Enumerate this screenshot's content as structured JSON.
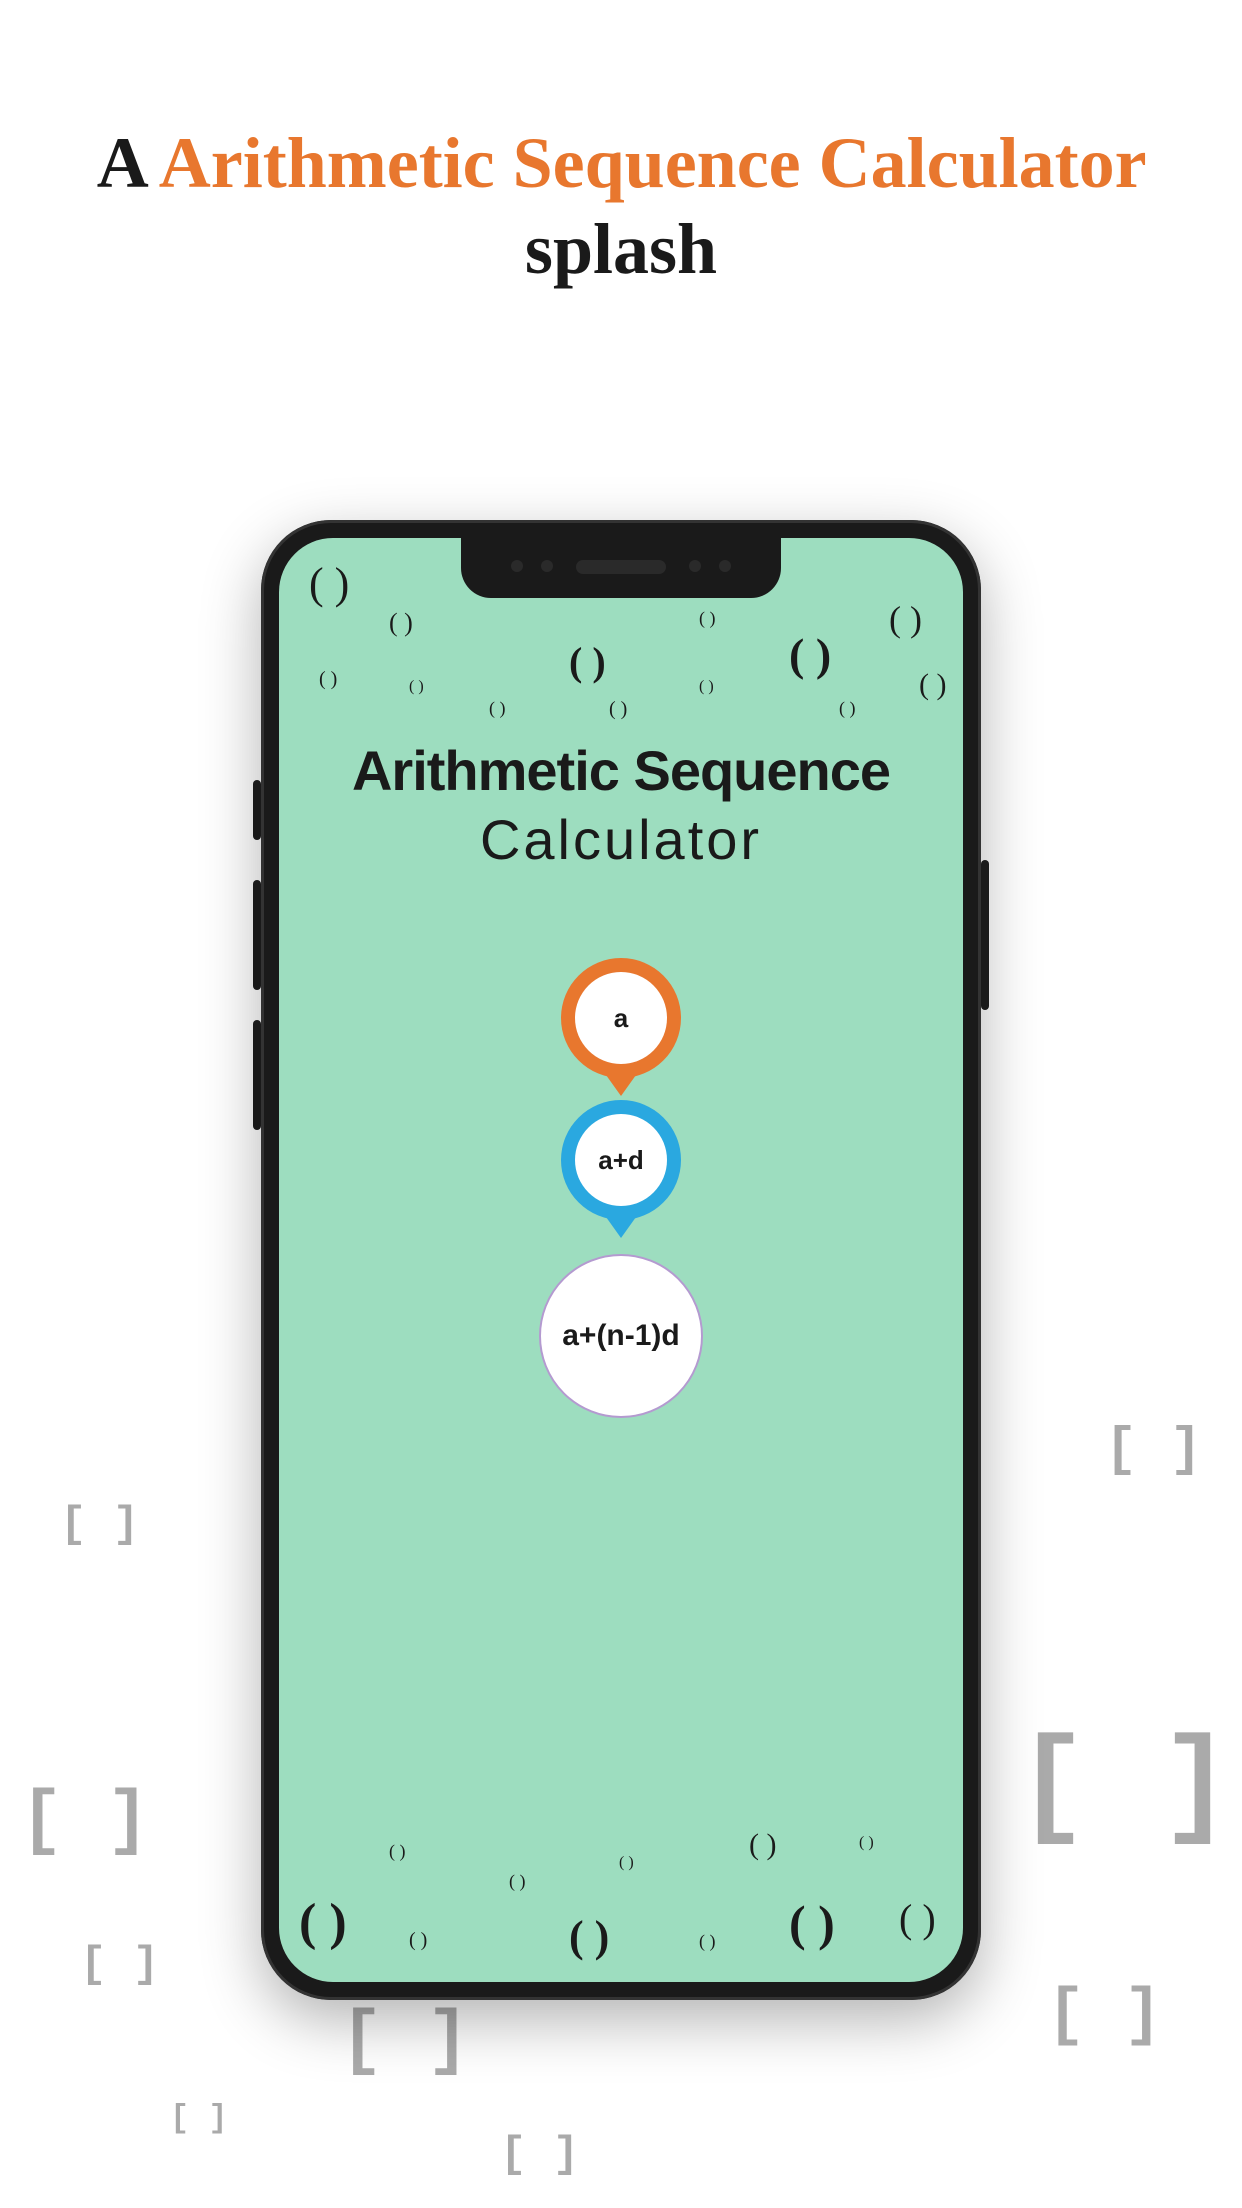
{
  "header": {
    "a": "A",
    "orange_text": "Arithmetic Sequence Calculator",
    "splash": "splash"
  },
  "app": {
    "title_bold": "Arithmetic Sequence",
    "title_light": "Calculator",
    "bubble1": "a",
    "bubble2": "a+d",
    "bubble3": "a+(n-1)d"
  },
  "decorations": {
    "paren_sm": "( )",
    "paren_md": "( )",
    "paren_lg": "( )",
    "bracket_sm": "[ ]",
    "bracket_lg": "[ ]"
  }
}
